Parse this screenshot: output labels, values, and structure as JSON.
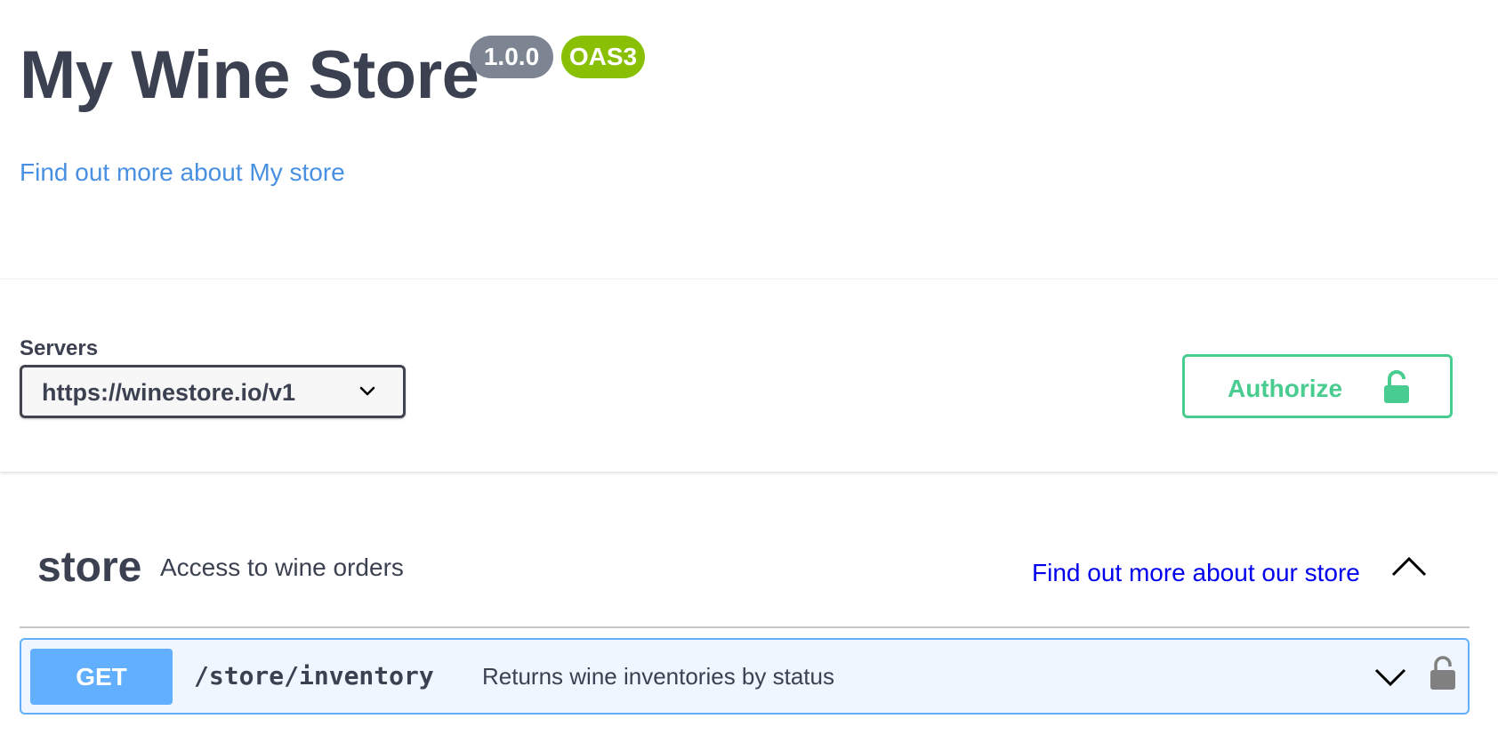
{
  "info": {
    "title": "My Wine Store",
    "version": "1.0.0",
    "oas": "OAS3",
    "link_text": "Find out more about My store"
  },
  "servers": {
    "label": "Servers",
    "selected": "https://winestore.io/v1"
  },
  "authorize": {
    "label": "Authorize"
  },
  "tag": {
    "name": "store",
    "description": "Access to wine orders",
    "link_text": "Find out more about our store"
  },
  "operation": {
    "method": "GET",
    "path": "/store/inventory",
    "summary": "Returns wine inventories by status"
  },
  "colors": {
    "text": "#3b4151",
    "version_badge": "#7d8492",
    "oas_badge": "#89bf04",
    "link": "#4990e2",
    "authorize": "#49cc90",
    "get": "#61affe",
    "get_bg": "#eff6ff"
  },
  "icons": {
    "server_select": "chevron-down-icon",
    "authorize": "unlocked-icon",
    "tag_toggle": "chevron-up-icon",
    "operation_toggle": "chevron-down-icon",
    "operation_lock": "lock-icon"
  }
}
